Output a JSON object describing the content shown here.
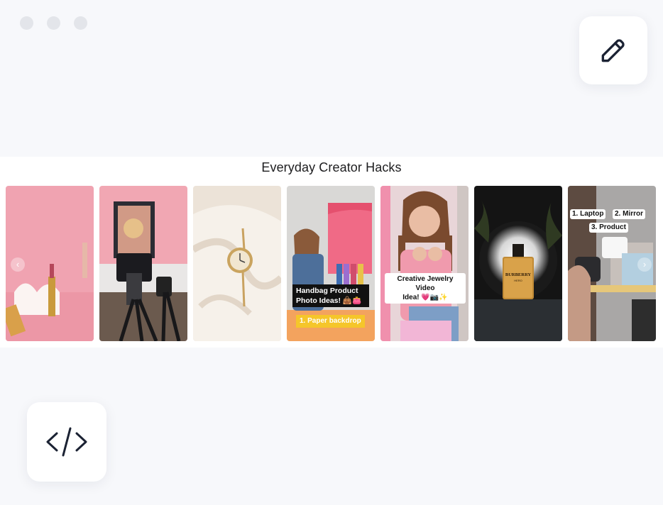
{
  "widget": {
    "title": "Everyday Creator Hacks",
    "cards": [
      {
        "name": "lipstick-photo"
      },
      {
        "name": "camera-setup-photo"
      },
      {
        "name": "watch-photo"
      },
      {
        "name": "handbag-photo",
        "caption_line1": "Handbag Product",
        "caption_line2": "Photo Ideas! 👜👛",
        "caption_sub": "1. Paper backdrop"
      },
      {
        "name": "jewelry-photo",
        "caption_line1": "Creative Jewelry Video",
        "caption_line2": "Idea! 💗📷✨"
      },
      {
        "name": "perfume-photo",
        "brand": "BURBERRY",
        "brand_sub": "HERO"
      },
      {
        "name": "setup-list-photo",
        "item1": "1. Laptop",
        "item2": "2. Mirror",
        "item3": "3. Product"
      }
    ],
    "prev_arrow": "‹",
    "next_arrow": "›"
  },
  "toolbar": {
    "edit_icon": "pencil-icon",
    "code_icon": "code-icon"
  },
  "colors": {
    "background": "#f7f8fb",
    "card_pink": "#f2a9b5"
  }
}
